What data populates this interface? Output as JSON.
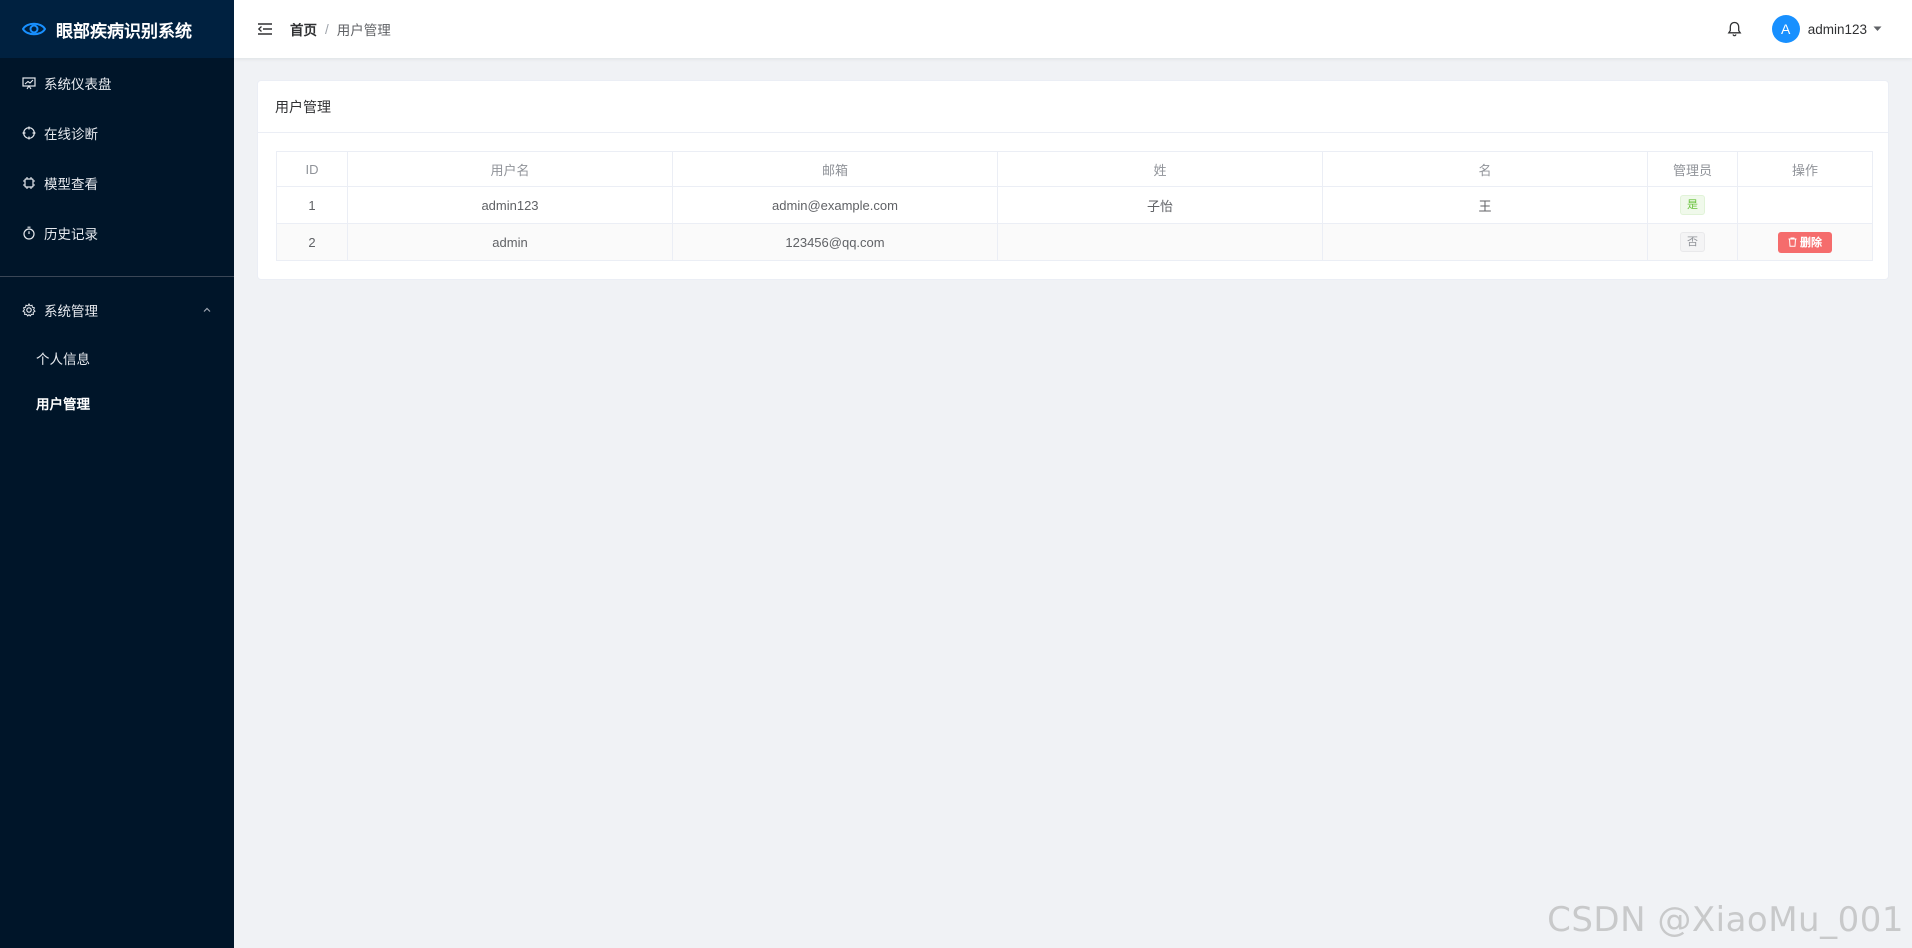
{
  "app": {
    "title": "眼部疾病识别系统"
  },
  "sidebar": {
    "items": [
      {
        "label": "系统仪表盘",
        "icon": "dashboard-icon"
      },
      {
        "label": "在线诊断",
        "icon": "crosshair-icon"
      },
      {
        "label": "模型查看",
        "icon": "chip-icon"
      },
      {
        "label": "历史记录",
        "icon": "stopwatch-icon"
      }
    ],
    "system_menu": {
      "label": "系统管理",
      "icon": "gear-icon",
      "sub_items": [
        {
          "label": "个人信息"
        },
        {
          "label": "用户管理"
        }
      ]
    }
  },
  "header": {
    "breadcrumb": {
      "home": "首页",
      "separator": "/",
      "current": "用户管理"
    },
    "user": {
      "avatar_letter": "A",
      "name": "admin123"
    }
  },
  "card": {
    "title": "用户管理"
  },
  "table": {
    "columns": [
      "ID",
      "用户名",
      "邮箱",
      "姓",
      "名",
      "管理员",
      "操作"
    ],
    "rows": [
      {
        "id": "1",
        "username": "admin123",
        "email": "admin@example.com",
        "last_name": "子怡",
        "first_name": "王",
        "is_admin": "是",
        "action": ""
      },
      {
        "id": "2",
        "username": "admin",
        "email": "123456@qq.com",
        "last_name": "",
        "first_name": "",
        "is_admin": "否",
        "action": "删除"
      }
    ]
  },
  "colors": {
    "sidebar_bg": "#001529",
    "logo_bg": "#002140",
    "accent": "#1890ff",
    "danger": "#f56c6c",
    "success": "#67c23a"
  },
  "watermark": "CSDN @XiaoMu_001"
}
